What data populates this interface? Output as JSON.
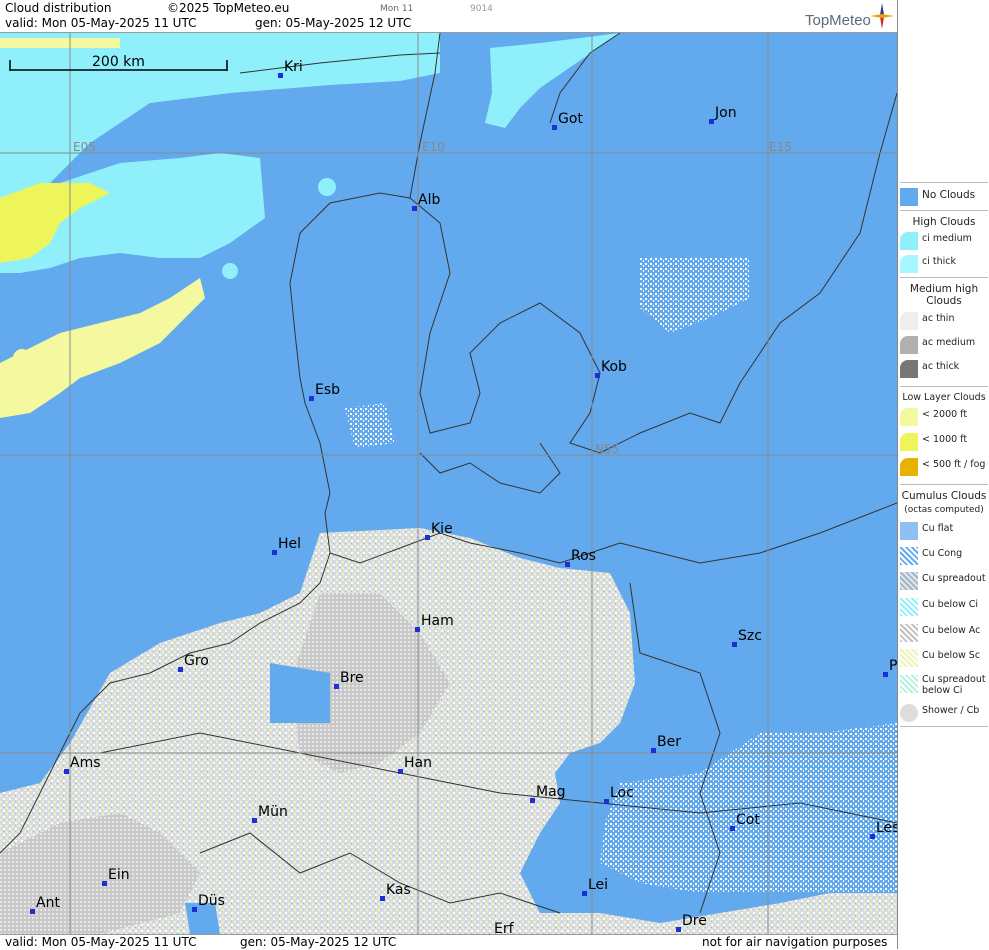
{
  "header": {
    "product": "Cloud distribution",
    "copyright": "©2025 TopMeteo.eu",
    "run_label": "Mon 11",
    "code": "9014",
    "valid_line": "valid:  Mon  05-May-2025  11 UTC",
    "gen_line": "gen: 05-May-2025 12 UTC",
    "logo": "TopMeteo"
  },
  "footer": {
    "valid_line": "valid:  Mon  05-May-2025  11 UTC",
    "gen_line": "gen: 05-May-2025 12 UTC",
    "disclaimer": "not for air navigation purposes"
  },
  "map": {
    "scale_label": "200 km",
    "grid_labels": [
      "E05",
      "E10",
      "E15",
      "N55"
    ],
    "cities": [
      "Kri",
      "Got",
      "Jon",
      "Alb",
      "Kob",
      "Esb",
      "Kie",
      "Hel",
      "Ros",
      "Ham",
      "Szc",
      "Gro",
      "Bre",
      "Ber",
      "Ams",
      "Han",
      "Mag",
      "Loc",
      "Mün",
      "Cot",
      "Les",
      "Ein",
      "Kas",
      "Lei",
      "Ant",
      "Düs",
      "Dre",
      "Erf",
      "P"
    ]
  },
  "legend": {
    "no_clouds": "No Clouds",
    "high_title": "High Clouds",
    "ci_medium": "ci medium",
    "ci_thick": "ci thick",
    "medium_title_1": "Medium high",
    "medium_title_2": "Clouds",
    "ac_thin": "ac thin",
    "ac_medium": "ac medium",
    "ac_thick": "ac thick",
    "low_title": "Low Layer Clouds",
    "low_2000": "< 2000 ft",
    "low_1000": "< 1000 ft",
    "low_500": "< 500 ft / fog",
    "cu_title": "Cumulus Clouds",
    "cu_sub": "(octas computed)",
    "cu_flat": "Cu flat",
    "cu_cong": "Cu Cong",
    "cu_spread": "Cu spreadout",
    "cu_below_ci": "Cu below Ci",
    "cu_below_ac": "Cu below Ac",
    "cu_below_sc": "Cu below Sc",
    "cu_spread_ci_1": "Cu spreadout",
    "cu_spread_ci_2": "below Ci",
    "shower": "Shower / Cb",
    "colors": {
      "no_clouds": "#63a9ee",
      "ci": "#8ff0fc",
      "low": "#f4f9a0",
      "low1000": "#eef55a",
      "fog": "#e9b200",
      "cu": "#dfe6ec"
    }
  }
}
